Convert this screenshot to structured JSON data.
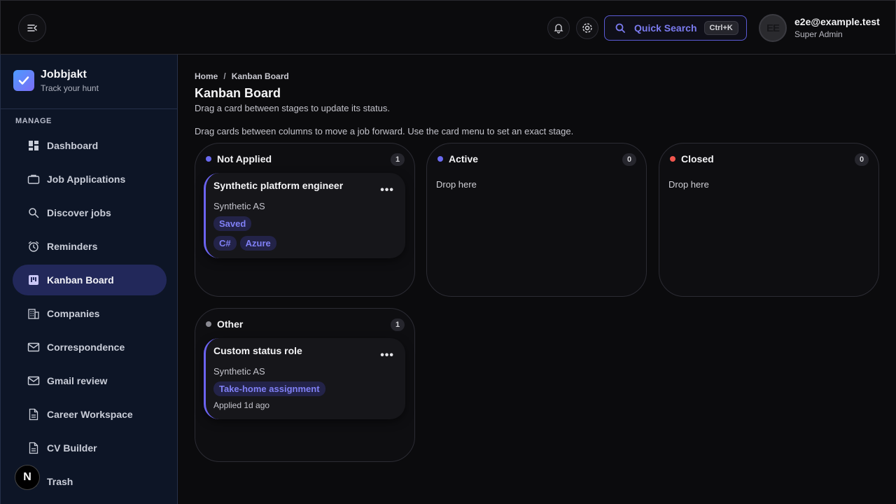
{
  "header": {
    "search_label": "Quick Search",
    "search_shortcut": "Ctrl+K",
    "avatar_initials": "EE",
    "user_email": "e2e@example.test",
    "user_role": "Super Admin"
  },
  "sidebar": {
    "brand_name": "Jobbjakt",
    "brand_tagline": "Track your hunt",
    "section_label": "MANAGE",
    "items": [
      {
        "label": "Dashboard",
        "icon": "dashboard-icon"
      },
      {
        "label": "Job Applications",
        "icon": "briefcase-icon"
      },
      {
        "label": "Discover jobs",
        "icon": "search-icon"
      },
      {
        "label": "Reminders",
        "icon": "alarm-clock-icon"
      },
      {
        "label": "Kanban Board",
        "icon": "kanban-icon",
        "active": true
      },
      {
        "label": "Companies",
        "icon": "building-icon"
      },
      {
        "label": "Correspondence",
        "icon": "mail-icon"
      },
      {
        "label": "Gmail review",
        "icon": "mail-icon"
      },
      {
        "label": "Career Workspace",
        "icon": "document-icon"
      },
      {
        "label": "CV Builder",
        "icon": "document-icon"
      },
      {
        "label": "Trash",
        "icon": "trash-icon"
      }
    ],
    "next_badge": "N"
  },
  "page": {
    "breadcrumb": [
      "Home",
      "Kanban Board"
    ],
    "title": "Kanban Board",
    "subtitle": "Drag a card between stages to update its status.",
    "hint": "Drag cards between columns to move a job forward. Use the card menu to set an exact stage."
  },
  "columns": [
    {
      "name": "Not Applied",
      "count": "1",
      "color": "#6a6af0",
      "cards": [
        {
          "title": "Synthetic platform engineer",
          "company": "Synthetic AS",
          "status": "Saved",
          "tags": [
            "C#",
            "Azure"
          ]
        }
      ]
    },
    {
      "name": "Active",
      "count": "0",
      "color": "#6a6af0",
      "drop_text": "Drop here",
      "cards": []
    },
    {
      "name": "Closed",
      "count": "0",
      "color": "#f0564e",
      "drop_text": "Drop here",
      "cards": []
    },
    {
      "name": "Other",
      "count": "1",
      "color": "#8a8a92",
      "cards": [
        {
          "title": "Custom status role",
          "company": "Synthetic AS",
          "status": "Take-home assignment",
          "applied": "Applied 1d ago"
        }
      ]
    }
  ],
  "colors": {
    "accent": "#5b5bd6",
    "sidebar_bg": "#0d1526",
    "active_nav": "#22285a"
  }
}
